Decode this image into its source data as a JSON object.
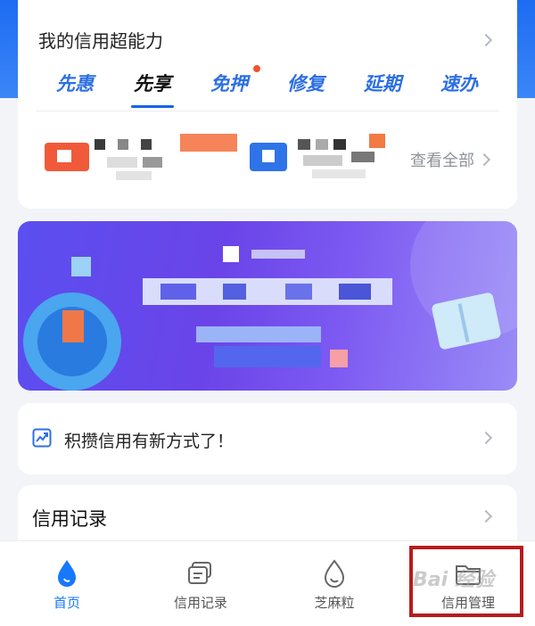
{
  "super_card": {
    "title": "我的信用超能力",
    "tabs": [
      {
        "label": "先惠"
      },
      {
        "label": "先享"
      },
      {
        "label": "免押"
      },
      {
        "label": "修复"
      },
      {
        "label": "延期"
      },
      {
        "label": "速办"
      }
    ],
    "active_tab": "先享",
    "view_all": "查看全部"
  },
  "promo_row": {
    "text": "积攒信用有新方式了！"
  },
  "record_section": {
    "title": "信用记录"
  },
  "tabbar": {
    "items": [
      {
        "label": "首页",
        "icon": "drop-icon",
        "active": true
      },
      {
        "label": "信用记录",
        "icon": "record-icon",
        "active": false
      },
      {
        "label": "芝麻粒",
        "icon": "sesame-icon",
        "active": false
      },
      {
        "label": "信用管理",
        "icon": "folder-icon",
        "active": false
      }
    ]
  },
  "watermark": "Bai 经验",
  "colors": {
    "accent": "#1677ff",
    "tab_text": "#2d6fe4",
    "highlight_box": "#b71c1c",
    "notification_dot": "#f0542c"
  }
}
